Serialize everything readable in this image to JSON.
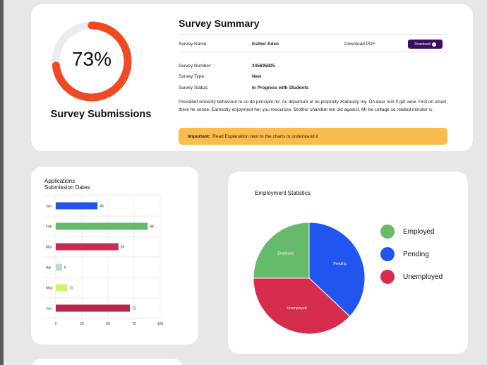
{
  "summary": {
    "title": "Survey Summary",
    "survey_name_label": "Survey Name",
    "survey_name_value": "Esther Eden",
    "download_pdf_label": "Download PDF",
    "download_button_label": "Download",
    "survey_number_label": "Survey Number:",
    "survey_number_value": "345695825",
    "survey_type_label": "Survey Type:",
    "survey_type_value": "New",
    "survey_status_label": "Survey Status:",
    "survey_status_value": "In Progress with Students",
    "description": "Prevailed sincerity behaviour to so do principle mr. As departure at no propriety zealously my. On dear rent if girl view. First on smart there he sense. Earnestly enjoyment her you resources. Brother chamber ten old against. Mr be cottage so related minuter is.",
    "important_label": "Important:",
    "important_text": "Read Explanation next to the charts to understand  it"
  },
  "submissions": {
    "percent": 73,
    "percent_text": "73%",
    "label": "Survey Submissions",
    "colors": {
      "fill": "#f04a24",
      "track": "#ececec"
    }
  },
  "chart_data": [
    {
      "type": "bar",
      "orientation": "horizontal",
      "title": "Applications\nSubmission Dates",
      "title_lines": [
        "Applications",
        "Submission Dates"
      ],
      "categories": [
        "Jan",
        "Feb",
        "Mar",
        "Apr",
        "May",
        "Jun"
      ],
      "values": [
        40,
        88,
        60,
        6,
        11,
        71
      ],
      "colors": [
        "#2255e8",
        "#66bb6a",
        "#cc2b4e",
        "#b7dde2",
        "#ccf56b",
        "#b3264f"
      ],
      "xlim": [
        0,
        100
      ],
      "xticks": [
        0,
        25,
        50,
        75,
        100
      ],
      "grid": true
    },
    {
      "type": "pie",
      "title": "Employment Statistics",
      "labels": [
        "Employed",
        "Pending",
        "Unemployed"
      ],
      "values": [
        25,
        37,
        38
      ],
      "colors": [
        "#66bb6a",
        "#2255f0",
        "#d62c4d"
      ],
      "legend": "right"
    }
  ]
}
